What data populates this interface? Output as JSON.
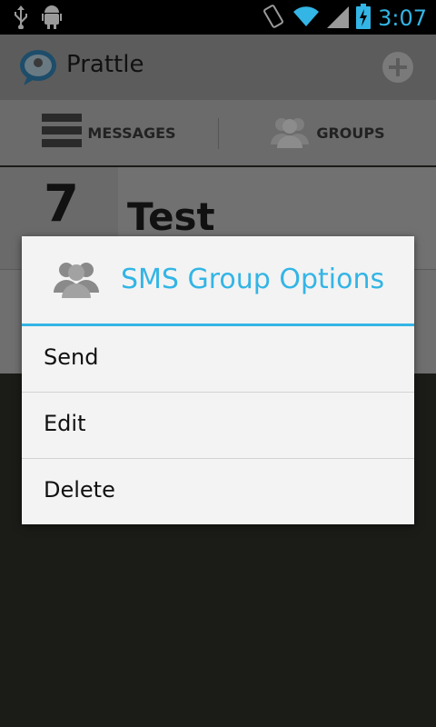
{
  "status_bar": {
    "time": "3:07",
    "icons": [
      "usb-icon",
      "android-debug-icon",
      "rotate-icon",
      "wifi-icon",
      "signal-icon",
      "battery-charging-icon"
    ]
  },
  "app": {
    "title": "Prattle",
    "tabs": [
      {
        "label": "MESSAGES",
        "icon": "messages-list-icon"
      },
      {
        "label": "GROUPS",
        "icon": "group-icon",
        "selected": true
      }
    ],
    "group_row": {
      "count": "7",
      "name": "Test"
    }
  },
  "dialog": {
    "title": "SMS Group Options",
    "icon": "group-icon",
    "items": [
      {
        "label": "Send"
      },
      {
        "label": "Edit"
      },
      {
        "label": "Delete"
      }
    ]
  },
  "colors": {
    "accent": "#33b5e5",
    "dim_background": "#1b1b18"
  }
}
